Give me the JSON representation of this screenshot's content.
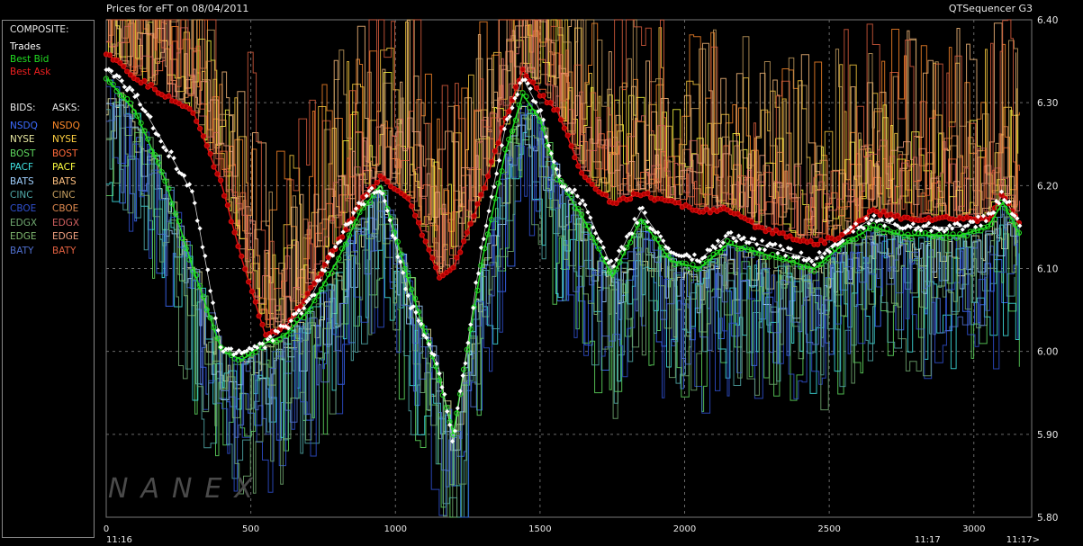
{
  "header": {
    "title_prefix": "Prices for",
    "symbol": "eFT",
    "on_label": "on",
    "date": "08/04/2011",
    "app_name": "QTSequencer G3"
  },
  "legend": {
    "composite_title": "COMPOSITE:",
    "trades": "Trades",
    "best_bid": "Best Bid",
    "best_ask": "Best Ask",
    "bids_title": "BIDS:",
    "asks_title": "ASKS:",
    "exchanges": [
      {
        "name": "NSDQ",
        "bid_color": "#3d6cff",
        "ask_color": "#ff8a2a"
      },
      {
        "name": "NYSE",
        "bid_color": "#e6e6a0",
        "ask_color": "#ffd040"
      },
      {
        "name": "BOST",
        "bid_color": "#5fd85f",
        "ask_color": "#ff6a3a"
      },
      {
        "name": "PACF",
        "bid_color": "#40e0e0",
        "ask_color": "#ffff40"
      },
      {
        "name": "BATS",
        "bid_color": "#9fd0ff",
        "ask_color": "#ffc080"
      },
      {
        "name": "CINC",
        "bid_color": "#50a8a8",
        "ask_color": "#c8a060"
      },
      {
        "name": "CBOE",
        "bid_color": "#3050d0",
        "ask_color": "#e08a50"
      },
      {
        "name": "EDGX",
        "bid_color": "#70a870",
        "ask_color": "#d06060"
      },
      {
        "name": "EDGE",
        "bid_color": "#80b870",
        "ask_color": "#f0a080"
      },
      {
        "name": "BATY",
        "bid_color": "#5070d0",
        "ask_color": "#e06040"
      }
    ]
  },
  "watermark": "NANEX",
  "chart_data": {
    "type": "line",
    "title": "Prices for eFT on 08/04/2011",
    "xlim": [
      0,
      3200
    ],
    "ylim": [
      5.8,
      6.4
    ],
    "x_ticks": [
      0,
      500,
      1000,
      1500,
      2000,
      2500,
      3000
    ],
    "x_tick_labels": [
      "0",
      "500",
      "1000",
      "1500",
      "2000",
      "2500",
      "3000"
    ],
    "y_ticks": [
      5.8,
      5.9,
      6.0,
      6.1,
      6.2,
      6.3,
      6.4
    ],
    "y_tick_labels": [
      "5.80",
      "5.90",
      "6.00",
      "6.10",
      "6.20",
      "6.30",
      "6.40"
    ],
    "time_labels": [
      {
        "x": 0,
        "text": "11:16"
      },
      {
        "x": 2840,
        "text": "11:17"
      },
      {
        "x": 3170,
        "text": "11:17>"
      }
    ],
    "grid": true,
    "colors": {
      "trades": "#ffffff",
      "best_bid": "#22dd22",
      "best_ask": "#dd1111"
    },
    "series": [
      {
        "name": "Best Ask",
        "x": [
          0,
          100,
          200,
          300,
          400,
          470,
          550,
          620,
          700,
          800,
          880,
          950,
          1050,
          1150,
          1200,
          1300,
          1380,
          1440,
          1500,
          1560,
          1650,
          1750,
          1850,
          1950,
          2050,
          2150,
          2250,
          2350,
          2450,
          2550,
          2650,
          2750,
          2850,
          2950,
          3050,
          3100,
          3160
        ],
        "y": [
          6.36,
          6.33,
          6.31,
          6.29,
          6.2,
          6.11,
          6.02,
          6.03,
          6.07,
          6.13,
          6.18,
          6.21,
          6.18,
          6.09,
          6.1,
          6.19,
          6.28,
          6.34,
          6.31,
          6.29,
          6.21,
          6.18,
          6.19,
          6.18,
          6.17,
          6.17,
          6.15,
          6.14,
          6.13,
          6.14,
          6.17,
          6.16,
          6.16,
          6.16,
          6.16,
          6.19,
          6.15
        ]
      },
      {
        "name": "Best Bid",
        "x": [
          0,
          100,
          200,
          300,
          400,
          470,
          550,
          620,
          700,
          800,
          880,
          950,
          1050,
          1150,
          1200,
          1300,
          1380,
          1440,
          1500,
          1560,
          1650,
          1750,
          1850,
          1950,
          2050,
          2150,
          2250,
          2350,
          2450,
          2550,
          2650,
          2750,
          2850,
          2950,
          3050,
          3100,
          3160
        ],
        "y": [
          6.33,
          6.29,
          6.21,
          6.1,
          6.0,
          5.99,
          6.01,
          6.02,
          6.05,
          6.11,
          6.17,
          6.2,
          6.08,
          5.97,
          5.9,
          6.11,
          6.24,
          6.31,
          6.28,
          6.21,
          6.16,
          6.09,
          6.16,
          6.11,
          6.1,
          6.13,
          6.12,
          6.11,
          6.1,
          6.13,
          6.15,
          6.14,
          6.14,
          6.14,
          6.15,
          6.18,
          6.14
        ]
      },
      {
        "name": "Trades",
        "x": [
          0,
          100,
          200,
          300,
          400,
          470,
          550,
          620,
          700,
          800,
          880,
          950,
          1050,
          1150,
          1200,
          1300,
          1380,
          1440,
          1500,
          1560,
          1650,
          1750,
          1850,
          1950,
          2050,
          2150,
          2250,
          2350,
          2450,
          2550,
          2650,
          2750,
          2850,
          2950,
          3050,
          3100,
          3160
        ],
        "y": [
          6.34,
          6.31,
          6.25,
          6.19,
          6.0,
          6.0,
          6.01,
          6.03,
          6.06,
          6.13,
          6.18,
          6.2,
          6.06,
          5.98,
          5.89,
          6.13,
          6.27,
          6.33,
          6.29,
          6.21,
          6.18,
          6.1,
          6.17,
          6.12,
          6.11,
          6.14,
          6.13,
          6.12,
          6.11,
          6.14,
          6.16,
          6.15,
          6.15,
          6.15,
          6.16,
          6.19,
          6.15
        ]
      }
    ]
  }
}
